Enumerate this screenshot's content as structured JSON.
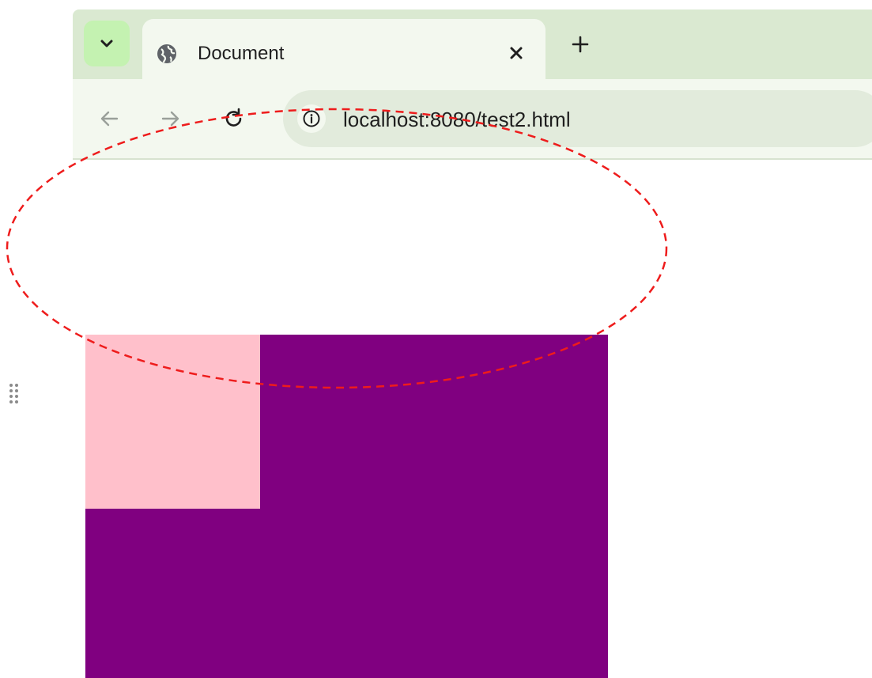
{
  "browser": {
    "tab": {
      "title": "Document",
      "favicon": "globe-icon"
    },
    "icons": {
      "tab_menu": "chevron-down-icon",
      "tab_close": "close-icon",
      "new_tab": "plus-icon",
      "back": "arrow-left-icon",
      "forward": "arrow-right-icon",
      "reload": "reload-icon",
      "site_info": "info-icon"
    },
    "address_bar": {
      "url": "localhost:8080/test2.html"
    }
  },
  "content": {
    "outer_box_color": "#800080",
    "inner_box_color": "#ffc0cb"
  },
  "annotation": {
    "shape": "ellipse",
    "style": "dashed",
    "color": "#ee1c1c"
  },
  "colors": {
    "tab_strip": "#dae9d1",
    "toolbar": "#f3f8ef",
    "omnibox": "#e2ebdc",
    "tab_menu_button": "#c4f2b1"
  }
}
